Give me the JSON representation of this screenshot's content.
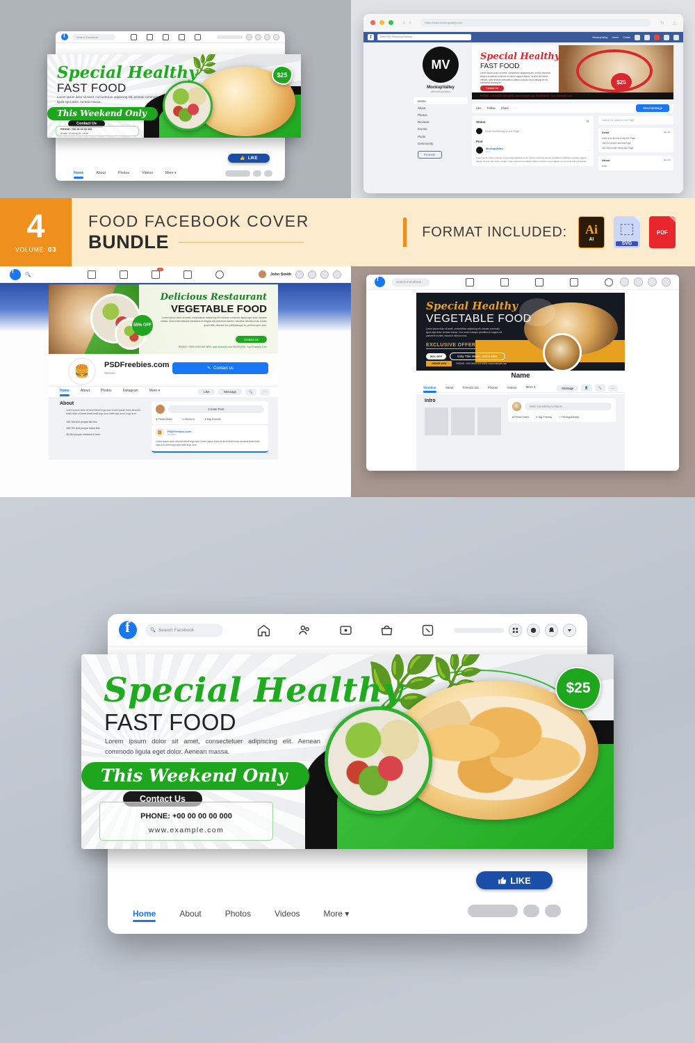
{
  "banner": {
    "volume_number": "4",
    "volume_label": "VOLUME:",
    "volume_value": "03",
    "title_line1": "FOOD FACEBOOK COVER",
    "title_line2": "BUNDLE",
    "format_label": "FORMAT INCLUDED:",
    "formats": [
      {
        "name": "ai-format-badge",
        "big": "Ai",
        "small": "AI"
      },
      {
        "name": "svg-format-badge",
        "small": "SVG"
      },
      {
        "name": "pdf-format-badge",
        "small": "PDF"
      }
    ],
    "colors": {
      "orange": "#ef8f1c",
      "cream": "#fcebcd",
      "ai_dark": "#2b1a05",
      "svg_blue": "#3a4fc4",
      "pdf_red": "#e8262c"
    }
  },
  "cover_green": {
    "script_title": "Special Healthy",
    "sub_title": "FAST FOOD",
    "body": "Lorem ipsum dolor sit amet, consectetuer adipiscing elit. Aenean commodo ligula eget dolor. Aenean massa.",
    "ribbon": "This Weekend Only",
    "contact_label": "Contact Us",
    "phone": "PHONE: +00 00 00 00 000",
    "website": "www.example.com",
    "price": "$25",
    "accent": "#1ea61e"
  },
  "fb_chrome": {
    "search_placeholder": "Search Facebook",
    "icons": [
      "home-icon",
      "friends-icon",
      "video-icon",
      "marketplace-icon",
      "groups-icon"
    ],
    "right_icons": [
      "menu-grid-icon",
      "messenger-icon",
      "notifications-icon",
      "account-chevron-icon"
    ]
  },
  "hero": {
    "like_label": "LIKE",
    "tabs": [
      {
        "label": "Home",
        "active": true
      },
      {
        "label": "About",
        "active": false
      },
      {
        "label": "Photos",
        "active": false
      },
      {
        "label": "Videos",
        "active": false
      },
      {
        "label": "More ▾",
        "active": false
      }
    ]
  },
  "mockup_top_left": {
    "title": "Facebook cover mockup — green Special Healthy Fast Food",
    "tabs": [
      "Home",
      "About",
      "Photos",
      "Videos",
      "More ▾"
    ],
    "like_label": "LIKE"
  },
  "mockup_top_right": {
    "browser_url": "https://www.mockupvalley.com",
    "fb_search": "Free PSD Facebook Mockup",
    "fb_nav": [
      "MockupValley",
      "Home",
      "Create"
    ],
    "avatar_initials": "MV",
    "page_name": "MockupValley",
    "page_handle": "@mockupvalley",
    "sidebar": [
      "Home",
      "About",
      "Photos",
      "Reviews",
      "Events",
      "Posts",
      "Community"
    ],
    "promote_button": "Promote",
    "actions": [
      "Like",
      "Follow",
      "Share"
    ],
    "send_message": "Send Message",
    "status_label": "Status",
    "status_placeholder": "Write Something on the Page",
    "post_label": "Post",
    "post_author": "MockupValley",
    "post_time": "1 hrs",
    "post_body": "Lorem ipsum dolor sit amet, consectetur adipiscing elit, sed do eiusmod tempor incididunt ut labore et dolore magna aliqua. Ut enim ad minim veniam, quis nostrud exercitation ullamco laboris nisi ut aliquip ex ea commodo consequat.",
    "search_posts_placeholder": "Search for posts on the Page",
    "card_titles": [
      "Artist",
      "About"
    ],
    "see_all": "See All",
    "artist_items": [
      "Invite your friends to like the Page",
      "158 611 people like this Page",
      "160 330 people follow this Page"
    ],
    "about_item": "Artist",
    "cover_title_script": "Special Healthy",
    "cover_title_sub": "FAST FOOD",
    "cover_price": "$25",
    "cover_contact": "Contact Us",
    "cover_strip": "PHONE: +000 0000 000    WEB: www.example.com    FACEBOOK: Your Example.Com"
  },
  "mockup_mid_left": {
    "fb_search_placeholder": "Search",
    "profile_name": "John Smith",
    "notification_count": "12",
    "cover_script": "Delicious Restaurant",
    "cover_sub": "VEGETABLE FOOD",
    "cover_body": "Lorem ipsum dolor sit amet, consectetuer adipiscing elit. Aenean commodo ligula eget dolor. Aenean massa. Cum sociis natoque penatibus et magnis dis parturient montes, nascetur ridiculus mus. Donec quam felis, ultricies nec, pellentesque eu, pretium quis, sem.",
    "cover_badge": "55% OFF",
    "cover_button": "Contact Us",
    "cover_strip": "PHONE: +0000 0000 000   WEB: www.example.com   FACEBOOK: Your Example.Com",
    "page_name": "PSDFreebies.com",
    "page_category": "Website",
    "contact_button": "Contact us",
    "tabs": [
      "Home",
      "About",
      "Photos",
      "Instagram",
      "More ▾"
    ],
    "actions": [
      "Like",
      "Message"
    ],
    "about_title": "About",
    "about_body": "Lorem ipsum dolor sit amet timeli ergo sum Lorem ipsum dolor sit amet timeli dolor sit amet timeli imeli ergo sum imeli ergo sum1 ergo sum.",
    "stats": [
      "159,784,623 people like this",
      "159,781,544 people follow this",
      "45,264 people checked in here"
    ],
    "create_post": "Create Post",
    "post_actions": [
      "Photo/Video",
      "Check In",
      "Tag Friends"
    ],
    "feed_author": "PSDFreebies.com",
    "feed_time": "30 mins",
    "feed_body": "Lorem ipsum dolor sit amet timeli ergo sum Lorem ipsum dolor sit amet timeli dolor sit amet timeli imeli ergo sum imeli ergo sum imeli ergo sum."
  },
  "mockup_mid_right": {
    "fb_search_placeholder": "Search Facebook",
    "cover_script": "Special Healthy",
    "cover_sub": "VEGETABLE FOOD",
    "cover_body": "Lorem ipsum dolor sit amet, consectetuer adipiscing elit. Aenean commodo ligula eget dolor. Aenean massa. Cum sociis natoque penatibus et magnis dis parturient montes, nascetur ridiculus mus.",
    "offer_label": "EXCLUSIVE OFFER",
    "offer_badge": "50% OFF",
    "offer_text": "Only This Week . Don't Miss",
    "order_label": "ORDER NOW",
    "contact_strip": "PHONE: +000 00000 000    WEB: www.example.com",
    "page_name": "Name",
    "tabs": [
      "Timeline",
      "About",
      "Friends 111",
      "Photos",
      "Videos",
      "More ▾"
    ],
    "message_button": "Message",
    "intro_title": "Intro",
    "composer_placeholder": "Write something to Name ...",
    "composer_actions": [
      "Photo/Video",
      "Tag Friends",
      "Feeling/Activity"
    ],
    "accent": "#e8a020"
  }
}
